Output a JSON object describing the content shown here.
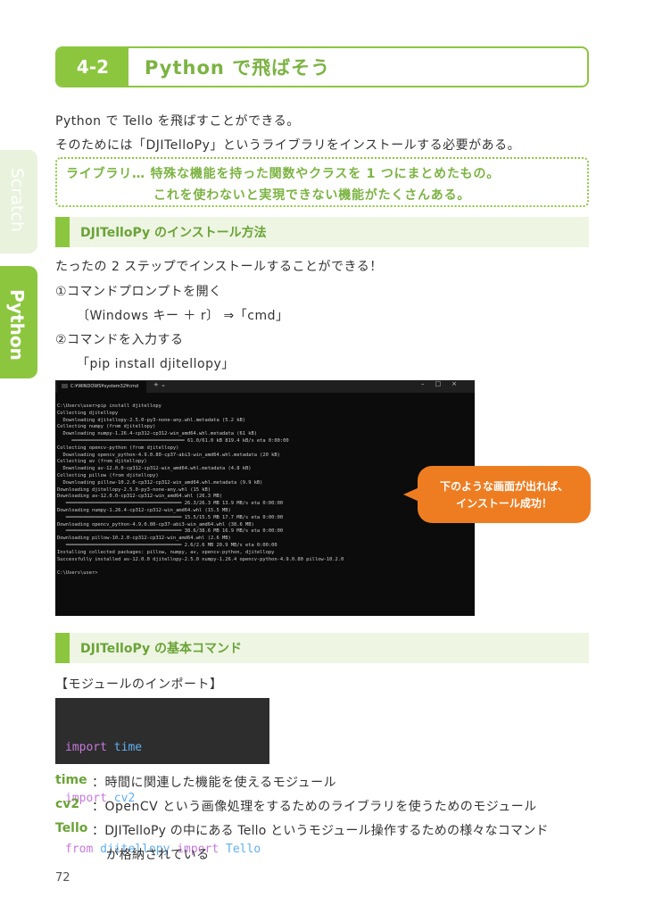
{
  "section": {
    "number": "4-2",
    "title": "Python で飛ばそう"
  },
  "side_tabs": {
    "scratch": "Scratch",
    "python": "Python"
  },
  "intro": {
    "line1": "Python で Tello を飛ばすことができる。",
    "line2": "そのためには「DJITelloPy」というライブラリをインストールする必要がある。"
  },
  "definition": {
    "line1": "ライブラリ… 特殊な機能を持った関数やクラスを 1 つにまとめたもの。",
    "line2": "これを使わないと実現できない機能がたくさんある。"
  },
  "install": {
    "heading": "DJITelloPy のインストール方法",
    "intro": "たったの 2 ステップでインストールすることができる！",
    "step1": "①コマンドプロンプトを開く",
    "step1_detail": "〔Windows キー ＋ r〕 ⇒「cmd」",
    "step2": "②コマンドを入力する",
    "step2_detail": "「pip install djitellopy」"
  },
  "terminal": {
    "tab_title": "C:¥WINDOWS¥system32¥cmd",
    "plus": "+  ⌄",
    "controls": "–□×",
    "lines": [
      "C:\\Users\\user>pip install djitellopy",
      "Collecting djitellopy",
      "  Downloading djitellopy-2.5.0-py3-none-any.whl.metadata (5.2 kB)",
      "Collecting numpy (from djitellopy)",
      "  Downloading numpy-1.26.4-cp312-cp312-win_amd64.whl.metadata (61 kB)",
      "     ━━━━━━━━━━━━━━━━━━━━━━━━━━━━━━━━━━━━━━━ 61.0/61.0 kB 819.4 kB/s eta 0:00:00",
      "Collecting opencv-python (from djitellopy)",
      "  Downloading opencv_python-4.9.0.80-cp37-abi3-win_amd64.whl.metadata (20 kB)",
      "Collecting av (from djitellopy)",
      "  Downloading av-12.0.0-cp312-cp312-win_amd64.whl.metadata (4.8 kB)",
      "Collecting pillow (from djitellopy)",
      "  Downloading pillow-10.2.0-cp312-cp312-win_amd64.whl.metadata (9.9 kB)",
      "Downloading djitellopy-2.5.0-py3-none-any.whl (15 kB)",
      "Downloading av-12.0.0-cp312-cp312-win_amd64.whl (26.3 MB)",
      "   ━━━━━━━━━━━━━━━━━━━━━━━━━━━━━━━━━━━━━━━━ 26.3/26.3 MB 13.9 MB/s eta 0:00:00",
      "Downloading numpy-1.26.4-cp312-cp312-win_amd64.whl (15.5 MB)",
      "   ━━━━━━━━━━━━━━━━━━━━━━━━━━━━━━━━━━━━━━━━ 15.5/15.5 MB 17.7 MB/s eta 0:00:00",
      "Downloading opencv_python-4.9.0.80-cp37-abi3-win_amd64.whl (38.6 MB)",
      "   ━━━━━━━━━━━━━━━━━━━━━━━━━━━━━━━━━━━━━━━━ 38.6/38.6 MB 16.9 MB/s eta 0:00:00",
      "Downloading pillow-10.2.0-cp312-cp312-win_amd64.whl (2.6 MB)",
      "   ━━━━━━━━━━━━━━━━━━━━━━━━━━━━━━━━━━━━━━━━ 2.6/2.6 MB 20.9 MB/s eta 0:00:00",
      "Installing collected packages: pillow, numpy, av, opencv-python, djitellopy",
      "Successfully installed av-12.0.0 djitellopy-2.5.0 numpy-1.26.4 opencv-python-4.9.0.80 pillow-10.2.0",
      "",
      "C:\\Users\\user>"
    ]
  },
  "callout": {
    "line1": "下のような画面が出れば、",
    "line2": "インストール成功！"
  },
  "basics": {
    "heading": "DJITelloPy の基本コマンド",
    "import_label": "【モジュールのインポート】",
    "code": [
      {
        "kw": "import",
        "rest": " time",
        "kw2": "",
        "rest2": ""
      },
      {
        "kw": "import",
        "rest": " cv2",
        "kw2": "",
        "rest2": ""
      },
      {
        "kw": "from",
        "rest": " djitellopy ",
        "kw2": "import",
        "rest2": " Tello"
      }
    ],
    "terms": [
      {
        "key": "time",
        "desc": "：時間に関連した機能を使えるモジュール"
      },
      {
        "key": "cv2",
        "desc": "：OpenCV という画像処理をするためのライブラリを使うためのモジュール"
      },
      {
        "key": "Tello",
        "desc": "：DJITelloPy の中にある Tello というモジュール操作するための様々なコマンド"
      }
    ],
    "terms_cont": "が格納されている"
  },
  "page_number": "72"
}
